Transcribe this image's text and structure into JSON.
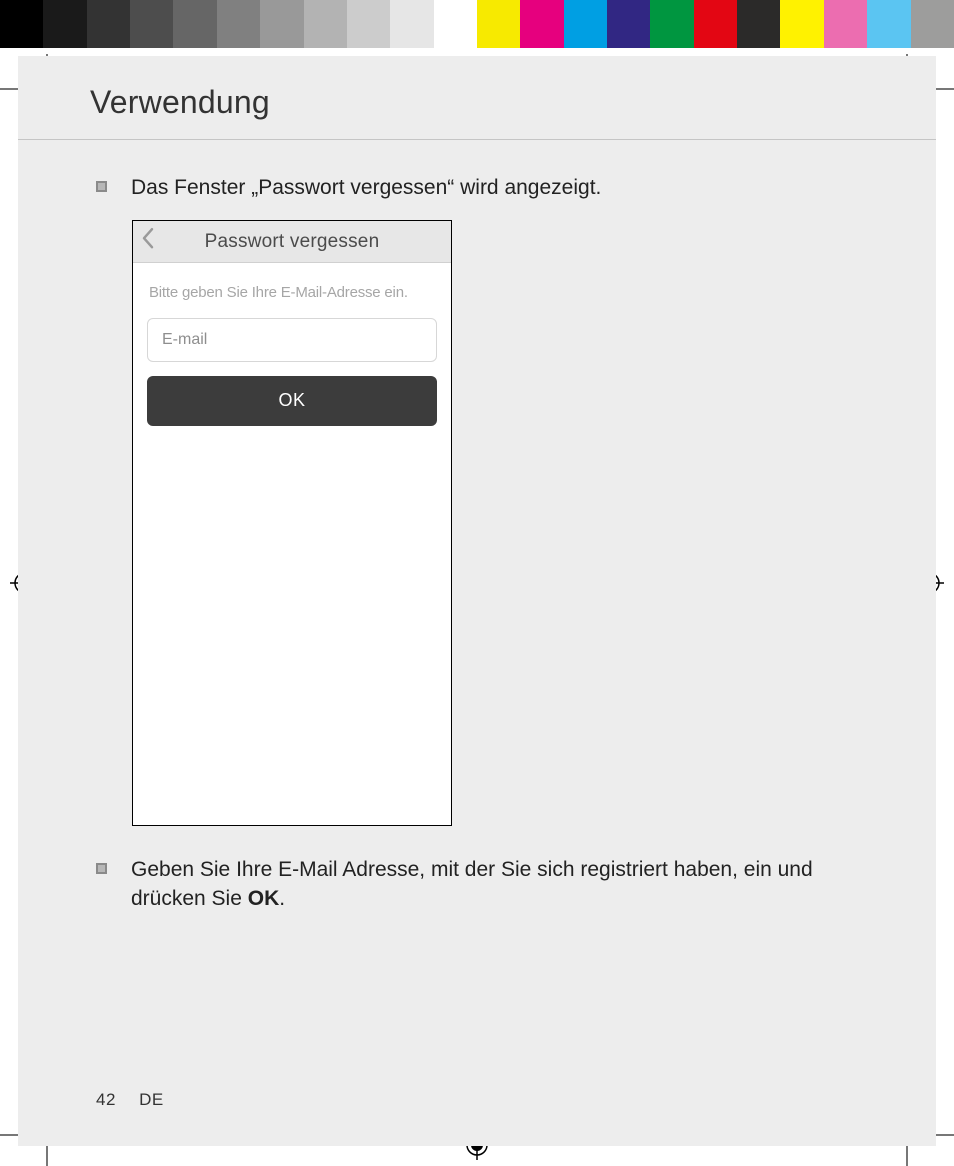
{
  "color_swatches_grayscale": [
    "#000000",
    "#1a1a1a",
    "#333333",
    "#4d4d4d",
    "#666666",
    "#808080",
    "#999999",
    "#b3b3b3",
    "#cccccc",
    "#e6e6e6",
    "#ffffff"
  ],
  "color_swatches_color": [
    "#f7ea00",
    "#e6007e",
    "#009fe3",
    "#312783",
    "#009640",
    "#e30613",
    "#2b2a29",
    "#fff200",
    "#ec6db0",
    "#5bc5f2",
    "#9d9d9c"
  ],
  "heading": "Verwendung",
  "bullets": {
    "b1": "Das Fenster „Passwort vergessen“ wird angezeigt.",
    "b2_pre": "Geben Sie Ihre E-Mail Adresse, mit der Sie sich registriert haben, ein und drücken Sie ",
    "b2_bold": "OK",
    "b2_post": "."
  },
  "phone": {
    "title": "Passwort vergessen",
    "instruction": "Bitte geben Sie Ihre E-Mail-Adresse ein.",
    "email_placeholder": "E-mail",
    "ok_label": "OK"
  },
  "footer": {
    "page_number": "42",
    "lang": "DE"
  }
}
